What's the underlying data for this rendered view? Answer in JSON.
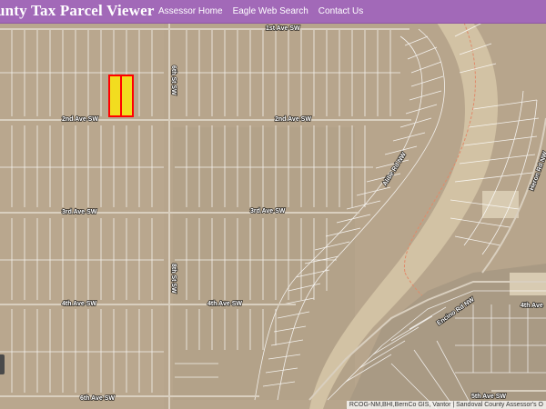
{
  "header": {
    "title": "unty Tax Parcel Viewer",
    "nav": [
      {
        "label": "Assessor Home"
      },
      {
        "label": "Eagle Web Search"
      },
      {
        "label": "Contact Us"
      }
    ]
  },
  "map": {
    "streets": {
      "first_ave": "1st Ave SW",
      "second_ave_left": "2nd Ave SW",
      "second_ave_right": "2nd Ave SW",
      "third_ave_left": "3rd Ave SW",
      "third_ave_right": "3rd Ave SW",
      "fourth_ave_left": "4th Ave SW",
      "fourth_ave_mid": "4th Ave SW",
      "fourth_ave_right": "4th Ave",
      "fifth_ave": "5th Ave SW",
      "sixth_ave": "6th Ave SW",
      "sixth_st": "6th St SW",
      "eighth_st": "8th St SW",
      "diag_left": "Alibe Rd NW",
      "diag_right": "Heron Rd NW",
      "lower_road": "Encino Rd NW"
    },
    "selected_parcel_color": "#ff0000",
    "selected_parcel_fill": "#f2dd1f",
    "attribution": "RCOG-NM,BHI,BernCo GIS, Vantor | Sandoval County Assessor's O"
  }
}
